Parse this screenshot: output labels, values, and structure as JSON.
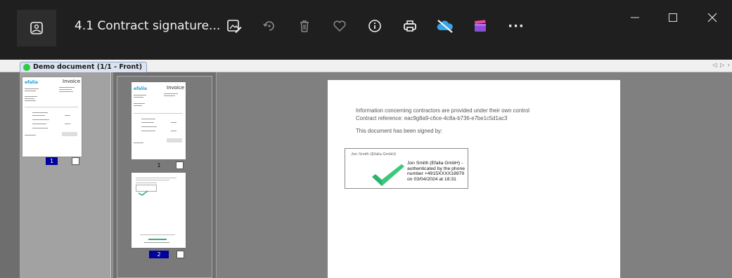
{
  "window": {
    "title": "4.1 Contract signature...",
    "controls": {
      "minimize": "minimize-icon",
      "maximize": "maximize-icon",
      "close": "close-icon"
    }
  },
  "toolbar": {
    "more_label": "···",
    "icons": [
      "edit-image-icon",
      "rotate-icon",
      "trash-icon",
      "heart-icon",
      "info-icon",
      "print-icon",
      "cloud-off-icon",
      "clapperboard-icon",
      "more-icon"
    ]
  },
  "tabs": [
    {
      "label": "Demo document (1/1 - Front)",
      "status_color": "#2ecc40"
    }
  ],
  "tab_scroll": "◁ ▷ ›",
  "thumbnails": {
    "pane1": [
      {
        "number": "1",
        "selected": true
      }
    ],
    "pane2": [
      {
        "number": "1",
        "selected": false
      },
      {
        "number": "2",
        "selected": true
      }
    ]
  },
  "invoice_thumb": {
    "logo": "efalia",
    "heading": "Invoice"
  },
  "document": {
    "line1": "Information concerning contractors are provided under their own control",
    "line2": "Contract reference: eac9g8a9-c6ce-4c8a-b736-e7be1c5d1ac3",
    "line3": "This document has been signed by:",
    "signature": {
      "label": "Jon Smith (Efalia GmbH)",
      "detail": "Jon Smith (Efalia GmbH) - authenticated by the phone number +4915XXXX18979 on 03/04/2024 at 18:31",
      "check_color": "#2fb36b"
    }
  },
  "colors": {
    "titlebar": "#1f1f1f",
    "selected_page": "#00009c",
    "accent_logo": "#19a0d8"
  }
}
